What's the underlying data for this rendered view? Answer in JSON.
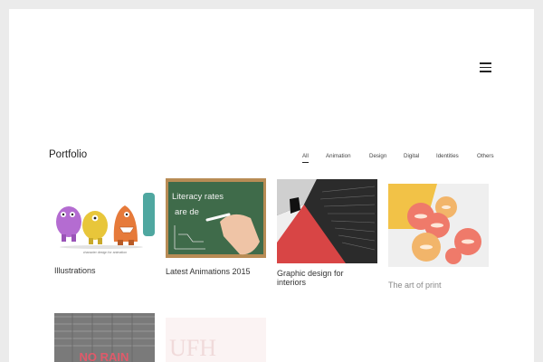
{
  "portfolio": {
    "title": "Portfolio",
    "filters": [
      "All",
      "Animation",
      "Design",
      "Digital",
      "Identities",
      "Others"
    ],
    "active_filter": "All"
  },
  "cards": [
    {
      "title": "Illustrations",
      "caption": "character design for animation"
    },
    {
      "title": "Latest Animations 2015",
      "board_line1": "Literacy rates",
      "board_line2": "are de"
    },
    {
      "title": "Graphic design for interiors"
    },
    {
      "title": "The art of print"
    },
    {
      "title": "",
      "tire_text": "NO RAIN"
    },
    {
      "title": "",
      "logo_text": "UFH"
    }
  ],
  "icons": {
    "menu": "hamburger-menu-icon"
  }
}
